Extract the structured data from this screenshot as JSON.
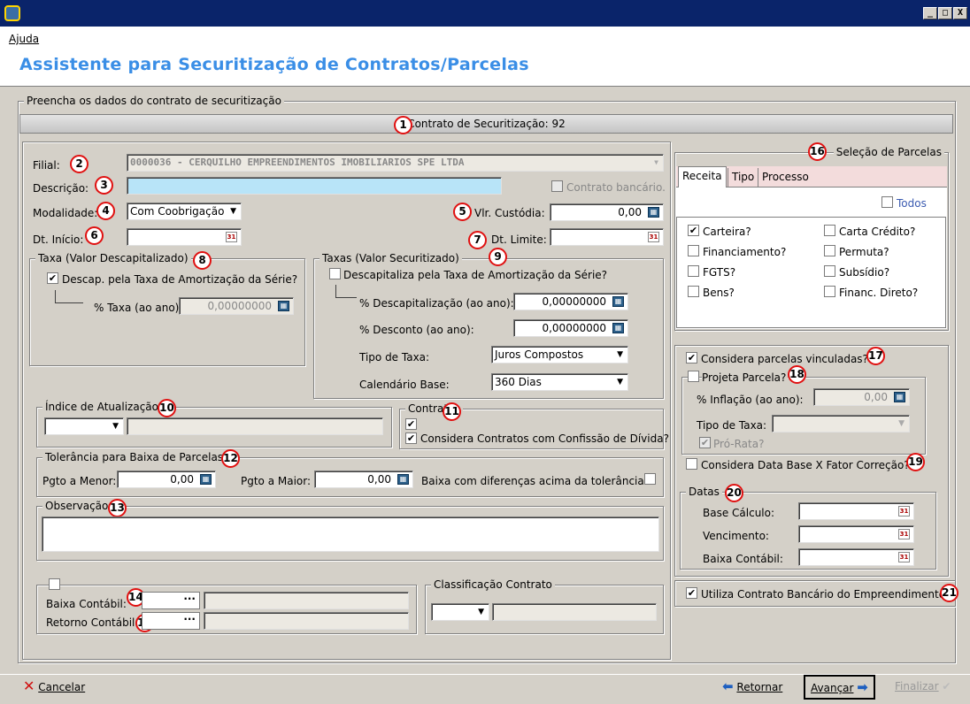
{
  "window": {
    "minimize": "_",
    "maximize": "□",
    "close": "X"
  },
  "menu": {
    "help": "Ajuda"
  },
  "title": "Assistente para Securitização de Contratos/Parcelas",
  "main_group": "Preencha os dados do contrato de securitização",
  "contract_header": "Contrato de Securitização: 92",
  "badges": [
    "1",
    "2",
    "3",
    "4",
    "5",
    "6",
    "7",
    "8",
    "9",
    "10",
    "11",
    "12",
    "13",
    "14",
    "15",
    "16",
    "17",
    "18",
    "19",
    "20",
    "21"
  ],
  "form": {
    "filial_label": "Filial:",
    "filial_value": "0000036 - CERQUILHO EMPREENDIMENTOS IMOBILIARIOS SPE LTDA",
    "descricao_label": "Descrição:",
    "descricao_value": "",
    "contrato_bancario": "Contrato bancário.",
    "modalidade_label": "Modalidade:",
    "modalidade_value": "Com Coobrigação",
    "vlr_custodia_label": "Vlr. Custódia:",
    "vlr_custodia_value": "0,00",
    "dt_inicio_label": "Dt. Início:",
    "dt_inicio_value": "",
    "dt_limite_label": "Dt. Limite:",
    "dt_limite_value": ""
  },
  "taxa_desc": {
    "legend": "Taxa (Valor Descapitalizado)",
    "check_label": "Descap. pela Taxa de Amortização da Série?",
    "taxa_label": "% Taxa (ao ano):",
    "taxa_value": "0,00000000"
  },
  "taxas_sec": {
    "legend": "Taxas (Valor Securitizado)",
    "check_label": "Descapitaliza pela Taxa de Amortização da Série?",
    "descap_label": "% Descapitalização (ao ano):",
    "descap_value": "0,00000000",
    "desconto_label": "% Desconto (ao ano):",
    "desconto_value": "0,00000000",
    "tipo_label": "Tipo de Taxa:",
    "tipo_value": "Juros Compostos",
    "cal_label": "Calendário Base:",
    "cal_value": "360 Dias"
  },
  "indice": {
    "legend": "Índice de Atualização"
  },
  "contratos": {
    "legend": "Contratos",
    "confissao": "Considera Contratos com Confissão de Dívida?"
  },
  "tolerancia": {
    "legend": "Tolerância para Baixa de Parcelas",
    "menor_label": "Pgto a Menor:",
    "menor_value": "0,00",
    "maior_label": "Pgto a Maior:",
    "maior_value": "0,00",
    "baixa_label": "Baixa com diferenças acima da tolerância?"
  },
  "observacao": {
    "legend": "Observação"
  },
  "contabil": {
    "baixa_label": "Baixa Contábil:",
    "retorno_label": "Retorno Contábil:",
    "dots": "···"
  },
  "classificacao": {
    "legend": "Classificação Contrato"
  },
  "selecao": {
    "legend": "Seleção de Parcelas",
    "tabs": [
      "Receita",
      "Tipo",
      "Processo"
    ],
    "todos": "Todos",
    "items": [
      "Carteira?",
      "Carta Crédito?",
      "Financiamento?",
      "Permuta?",
      "FGTS?",
      "Subsídio?",
      "Bens?",
      "Financ. Direto?"
    ]
  },
  "vinculadas": {
    "label": "Considera parcelas vinculadas?",
    "projeta": "Projeta Parcela?",
    "inflacao_label": "% Inflação (ao ano):",
    "inflacao_value": "0,00",
    "tipo_label": "Tipo de Taxa:",
    "prorata": "Pró-Rata?",
    "data_base": "Considera Data Base X Fator Correção?"
  },
  "datas": {
    "legend": "Datas",
    "base": "Base Cálculo:",
    "venc": "Vencimento:",
    "baixa": "Baixa Contábil:"
  },
  "utiliza": "Utiliza Contrato Bancário do Empreendimento?",
  "buttons": {
    "cancelar": "Cancelar",
    "retornar": "Retornar",
    "avancar": "Avançar",
    "finalizar": "Finalizar"
  },
  "colors": {
    "title": "#3a8ee6",
    "badge": "#e01010",
    "descricao_bg": "#b8e4f8",
    "titlebar": "#0a246a"
  }
}
